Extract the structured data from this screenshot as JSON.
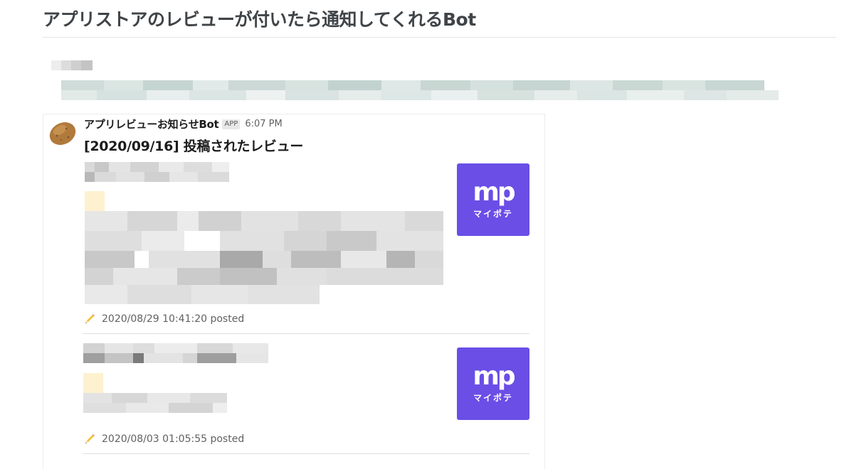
{
  "page": {
    "title": "アプリストアのレビューが付いたら通知してくれるBot"
  },
  "message": {
    "bot_name": "アプリレビューお知らせBot",
    "app_badge": "APP",
    "time": "6:07 PM",
    "heading": "[2020/09/16] 投稿されたレビュー"
  },
  "reviews": [
    {
      "posted_text": "2020/08/29 10:41:20 posted",
      "app_icon": {
        "logo": "mp",
        "caption": "マイポテ",
        "color": "#6a4ee6"
      }
    },
    {
      "posted_text": "2020/08/03 01:05:55 posted",
      "app_icon": {
        "logo": "mp",
        "caption": "マイポテ",
        "color": "#6a4ee6"
      }
    }
  ],
  "icons": {
    "avatar": "potato-icon",
    "posted": "pencil-icon"
  },
  "colors": {
    "app_icon_bg": "#6a4ee6",
    "title_text": "#3f4448",
    "muted_text": "#616061"
  }
}
